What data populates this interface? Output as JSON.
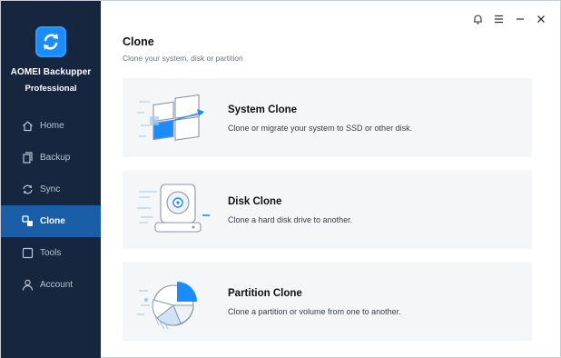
{
  "app": {
    "name": "AOMEI Backupper",
    "edition": "Professional"
  },
  "sidebar": {
    "items": [
      {
        "label": "Home",
        "icon": "home-icon"
      },
      {
        "label": "Backup",
        "icon": "backup-icon"
      },
      {
        "label": "Sync",
        "icon": "sync-icon"
      },
      {
        "label": "Clone",
        "icon": "clone-icon",
        "active": true
      },
      {
        "label": "Tools",
        "icon": "tools-icon"
      },
      {
        "label": "Account",
        "icon": "account-icon"
      }
    ]
  },
  "titlebar": {
    "icons": [
      "bell-icon",
      "menu-icon",
      "minimize-icon",
      "close-icon"
    ]
  },
  "main": {
    "title": "Clone",
    "subtitle": "Clone your system, disk or partition",
    "cards": [
      {
        "title": "System Clone",
        "description": "Clone or migrate your system to SSD or other disk.",
        "icon": "windows-system-icon"
      },
      {
        "title": "Disk Clone",
        "description": "Clone a hard disk drive to another.",
        "icon": "hard-disk-icon"
      },
      {
        "title": "Partition Clone",
        "description": "Clone a partition or volume from one to another.",
        "icon": "pie-partition-icon"
      }
    ]
  },
  "colors": {
    "sidebar_bg": "#16263f",
    "active_item": "#1b5ea8",
    "accent": "#1b8cff",
    "card_bg": "#f5f6f7"
  }
}
